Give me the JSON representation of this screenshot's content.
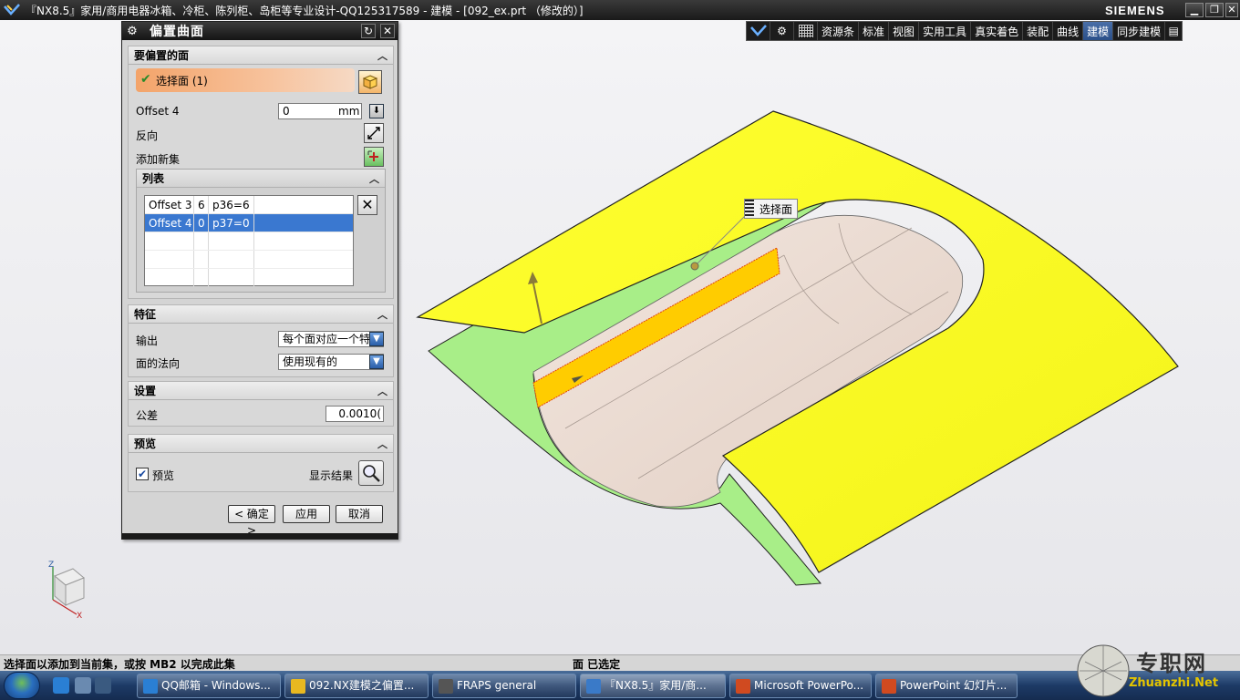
{
  "window": {
    "title": "『NX8.5』家用/商用电器冰箱、冷柜、陈列柜、岛柜等专业设计-QQ125317589 - 建模 - [092_ex.prt （修改的）]",
    "brand": "SIEMENS",
    "min_label": "▁",
    "max_label": "❐",
    "close_label": "✕"
  },
  "ribbon": {
    "tabs": [
      "资源条",
      "标准",
      "视图",
      "实用工具",
      "真实着色",
      "装配",
      "曲线",
      "建模",
      "同步建模"
    ],
    "active_tab": "建模",
    "menu_icon": "▤"
  },
  "dialog": {
    "title": "偏置曲面",
    "reset_icon": "↻",
    "close_icon": "✕",
    "faces_section": {
      "header": "要偏置的面",
      "select_label": "选择面 (1)",
      "offset_label": "Offset 4",
      "offset_value": "0",
      "offset_unit": "mm",
      "reverse_label": "反向",
      "add_set_label": "添加新集",
      "list": {
        "header": "列表",
        "rows": [
          {
            "name": "Offset 3",
            "value": "6",
            "expr": "p36=6",
            "selected": false
          },
          {
            "name": "Offset 4",
            "value": "0",
            "expr": "p37=0",
            "selected": true
          }
        ]
      }
    },
    "feature_section": {
      "header": "特征",
      "output_label": "输出",
      "output_value": "每个面对应一个特",
      "normal_label": "面的法向",
      "normal_value": "使用现有的"
    },
    "settings_section": {
      "header": "设置",
      "tolerance_label": "公差",
      "tolerance_value": "0.0010("
    },
    "preview_section": {
      "header": "预览",
      "preview_label": "预览",
      "preview_checked": true,
      "show_result_label": "显示结果"
    },
    "buttons": {
      "ok": "< 确定 >",
      "apply": "应用",
      "cancel": "取消"
    }
  },
  "viewport": {
    "tooltip": "选择面",
    "triad_z": "Z",
    "triad_x": "X"
  },
  "statusbar": {
    "prompt": "选择面以添加到当前集，或按 MB2 以完成此集",
    "status": "面 已选定"
  },
  "taskbar": {
    "items": [
      {
        "label": "QQ邮箱 - Windows...",
        "color": "#2a7fd4"
      },
      {
        "label": "092.NX建模之偏置...",
        "color": "#e8b820"
      },
      {
        "label": "FRAPS general",
        "color": "#555555"
      },
      {
        "label": "『NX8.5』家用/商...",
        "color": "#3a7ac8"
      },
      {
        "label": "Microsoft PowerPo...",
        "color": "#d04a20"
      },
      {
        "label": "PowerPoint 幻灯片...",
        "color": "#d04a20"
      }
    ],
    "active_index": 3
  },
  "watermark": {
    "text": "专职网",
    "url": "Zhuanzhi.Net"
  },
  "colors": {
    "surface_yellow": "#ffff2a",
    "surface_green": "#a8ee88",
    "body_pink": "#eddcd2",
    "highlight_orange": "#ffcc00",
    "selection_blue": "#3a78d0"
  }
}
